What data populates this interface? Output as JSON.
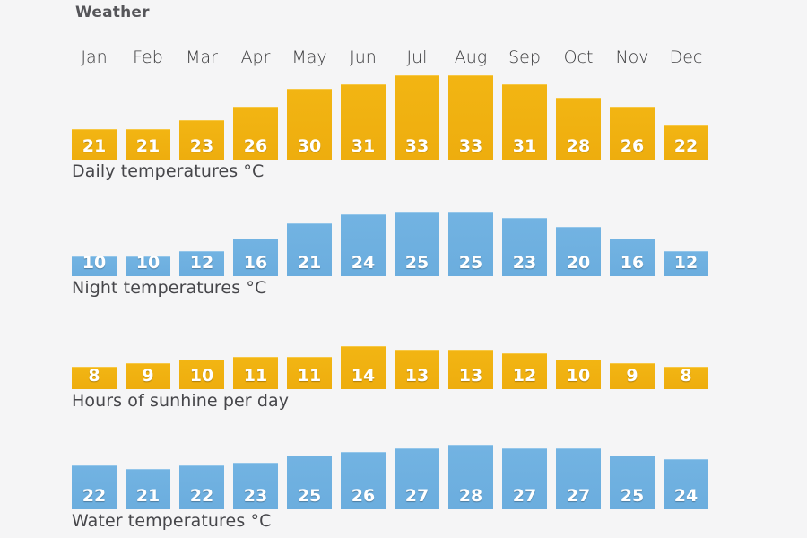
{
  "header": {
    "title": "Weather"
  },
  "months": [
    "Jan",
    "Feb",
    "Mar",
    "Apr",
    "May",
    "Jun",
    "Jul",
    "Aug",
    "Sep",
    "Oct",
    "Nov",
    "Dec"
  ],
  "colors": {
    "orange": "#efb113",
    "blue": "#69aee0",
    "background": "#f5f5f6",
    "label_text": "#46464a",
    "title_text": "#555559",
    "bar_value_text": "#ffffff"
  },
  "sections": [
    {
      "key": "daily",
      "label": "Daily temperatures °C",
      "color": "orange",
      "unit": "°C",
      "values": [
        21,
        21,
        23,
        26,
        30,
        31,
        33,
        33,
        31,
        28,
        26,
        22
      ]
    },
    {
      "key": "night",
      "label": "Night temperatures °C",
      "color": "blue",
      "unit": "°C",
      "values": [
        10,
        10,
        12,
        16,
        21,
        24,
        25,
        25,
        23,
        20,
        16,
        12
      ]
    },
    {
      "key": "sun",
      "label": "Hours of sunhine per day",
      "color": "orange",
      "unit": "h",
      "values": [
        8,
        9,
        10,
        11,
        11,
        14,
        13,
        13,
        12,
        10,
        9,
        8
      ]
    },
    {
      "key": "water",
      "label": "Water temperatures °C",
      "color": "blue",
      "unit": "°C",
      "values": [
        22,
        21,
        22,
        23,
        25,
        26,
        27,
        28,
        27,
        27,
        25,
        24
      ]
    }
  ],
  "chart_data": {
    "type": "bar",
    "title": "Weather",
    "xlabel": "",
    "ylabel": "",
    "grid": false,
    "legend": "none",
    "categories": [
      "Jan",
      "Feb",
      "Mar",
      "Apr",
      "May",
      "Jun",
      "Jul",
      "Aug",
      "Sep",
      "Oct",
      "Nov",
      "Dec"
    ],
    "series": [
      {
        "name": "Daily temperatures °C",
        "unit": "°C",
        "color": "#efb113",
        "values": [
          21,
          21,
          23,
          26,
          30,
          31,
          33,
          33,
          31,
          28,
          26,
          22
        ]
      },
      {
        "name": "Night temperatures °C",
        "unit": "°C",
        "color": "#69aee0",
        "values": [
          10,
          10,
          12,
          16,
          21,
          24,
          25,
          25,
          23,
          20,
          16,
          12
        ]
      },
      {
        "name": "Hours of sunhine per day",
        "unit": "hours",
        "color": "#efb113",
        "values": [
          8,
          9,
          10,
          11,
          11,
          14,
          13,
          13,
          12,
          10,
          9,
          8
        ]
      },
      {
        "name": "Water temperatures °C",
        "unit": "°C",
        "color": "#69aee0",
        "values": [
          22,
          21,
          22,
          23,
          25,
          26,
          27,
          28,
          27,
          27,
          25,
          24
        ]
      }
    ]
  }
}
